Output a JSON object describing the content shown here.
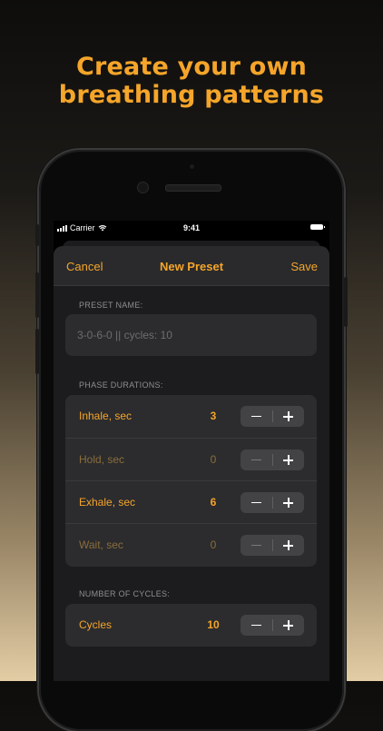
{
  "headline": {
    "line1": "Create your own",
    "line2": "breathing patterns"
  },
  "status_bar": {
    "carrier": "Carrier",
    "time": "9:41"
  },
  "nav": {
    "cancel_label": "Cancel",
    "title": "New Preset",
    "save_label": "Save"
  },
  "preset_name": {
    "section_label": "PRESET NAME:",
    "value": "",
    "placeholder": "3-0-6-0 || cycles: 10"
  },
  "phases": {
    "section_label": "PHASE DURATIONS:",
    "rows": [
      {
        "label": "Inhale, sec",
        "value": "3",
        "minus_enabled": true
      },
      {
        "label": "Hold, sec",
        "value": "0",
        "minus_enabled": false
      },
      {
        "label": "Exhale, sec",
        "value": "6",
        "minus_enabled": true
      },
      {
        "label": "Wait, sec",
        "value": "0",
        "minus_enabled": false
      }
    ]
  },
  "cycles": {
    "section_label": "NUMBER OF CYCLES:",
    "label": "Cycles",
    "value": "10",
    "minus_enabled": true
  },
  "colors": {
    "accent": "#f5a52a",
    "dimmed_accent": "#8a6d3c",
    "sheet_background": "#1c1c1e",
    "group_background": "#2c2c2e"
  },
  "icons": [
    "wifi-icon",
    "signal-bars-icon",
    "battery-icon",
    "minus-icon",
    "plus-icon"
  ]
}
